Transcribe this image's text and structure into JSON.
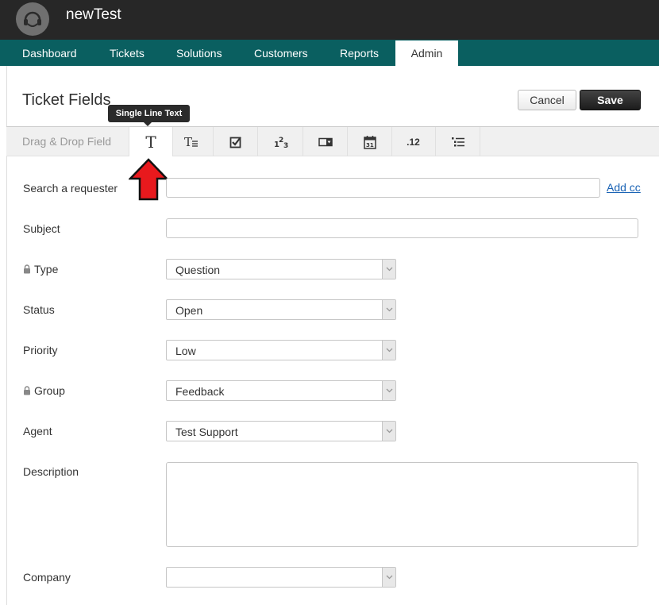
{
  "app": {
    "title": "newTest"
  },
  "nav": {
    "items": [
      {
        "label": "Dashboard"
      },
      {
        "label": "Tickets"
      },
      {
        "label": "Solutions"
      },
      {
        "label": "Customers"
      },
      {
        "label": "Reports"
      },
      {
        "label": "Admin",
        "active": true
      }
    ]
  },
  "page": {
    "title": "Ticket Fields"
  },
  "actions": {
    "cancel_label": "Cancel",
    "save_label": "Save"
  },
  "field_toolbar": {
    "label": "Drag & Drop Field",
    "tooltip": "Single Line Text",
    "tools": [
      {
        "icon": "single-line-text-icon",
        "glyph": "T"
      },
      {
        "icon": "multi-line-text-icon"
      },
      {
        "icon": "checkbox-icon"
      },
      {
        "icon": "number-icon",
        "glyph": "1 2 3"
      },
      {
        "icon": "dropdown-icon"
      },
      {
        "icon": "date-icon",
        "glyph": "31"
      },
      {
        "icon": "decimal-icon",
        "glyph": ".12"
      },
      {
        "icon": "nested-list-icon"
      }
    ]
  },
  "form": {
    "requester": {
      "label": "Search a requester",
      "value": "",
      "add_cc": "Add cc"
    },
    "subject": {
      "label": "Subject",
      "value": ""
    },
    "type": {
      "label": "Type",
      "value": "Question",
      "locked": true
    },
    "status": {
      "label": "Status",
      "value": "Open"
    },
    "priority": {
      "label": "Priority",
      "value": "Low"
    },
    "group": {
      "label": "Group",
      "value": "Feedback",
      "locked": true
    },
    "agent": {
      "label": "Agent",
      "value": "Test Support"
    },
    "description": {
      "label": "Description",
      "value": ""
    },
    "company": {
      "label": "Company",
      "value": ""
    }
  },
  "colors": {
    "nav_bg": "#0a5f60",
    "topbar_bg": "#272727",
    "link": "#1a63b5",
    "arrow": "#e8191d"
  }
}
